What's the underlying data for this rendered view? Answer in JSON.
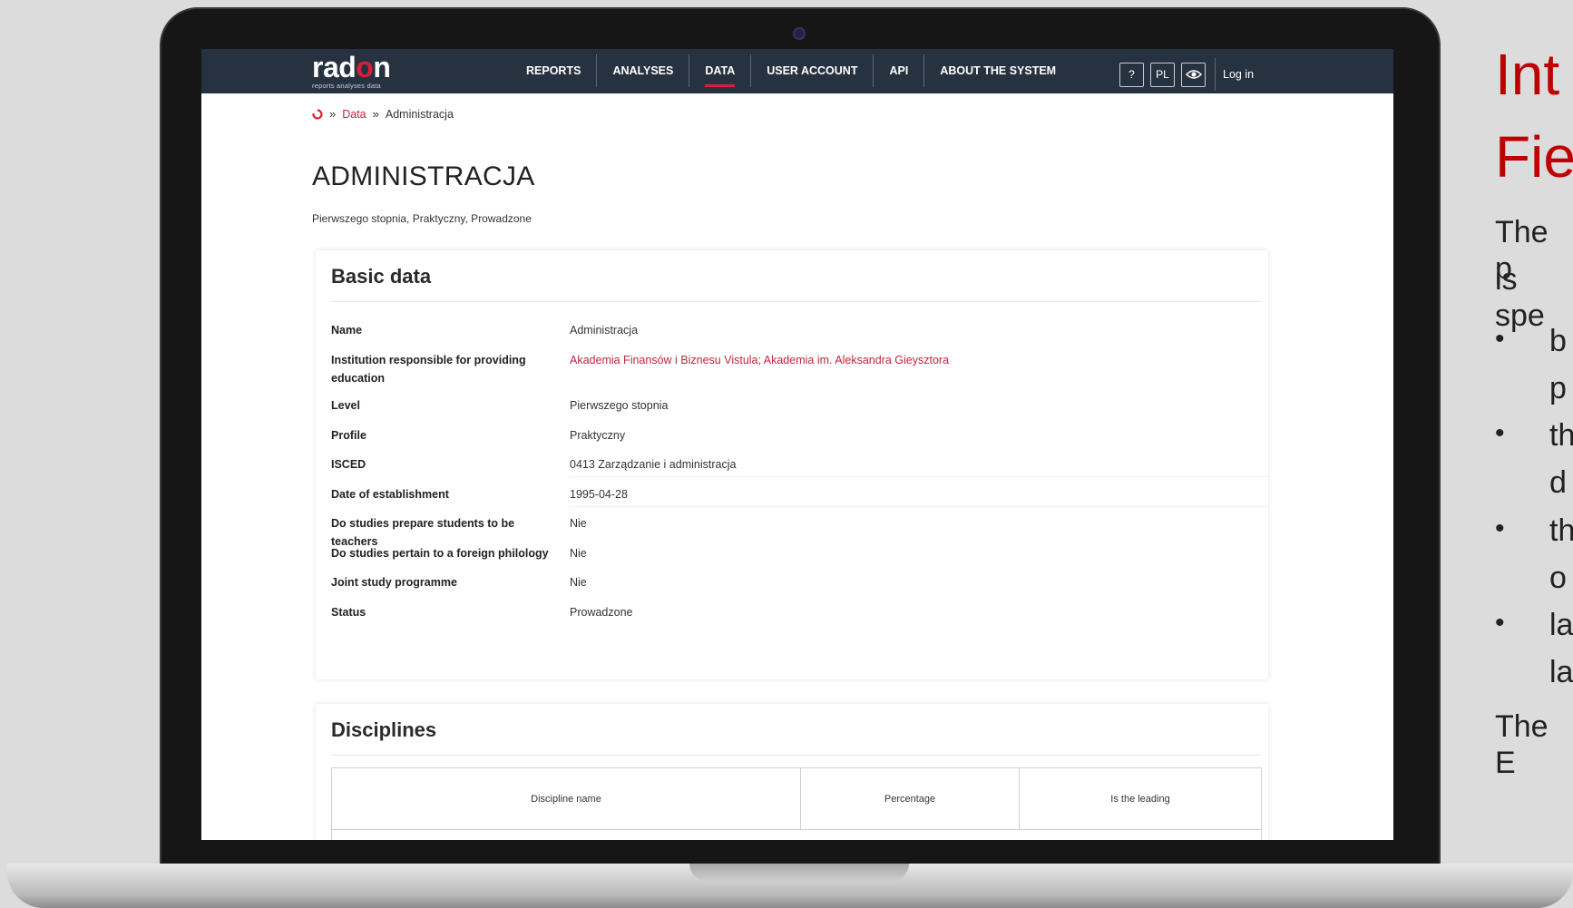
{
  "app": {
    "logo_text_start": "rad",
    "logo_text_o": "o",
    "logo_text_end": "n",
    "logo_subtitle": "reports   analyses   data"
  },
  "nav": {
    "items": [
      {
        "label": "REPORTS",
        "active": false
      },
      {
        "label": "ANALYSES",
        "active": false
      },
      {
        "label": "DATA",
        "active": true
      },
      {
        "label": "USER ACCOUNT",
        "active": false
      },
      {
        "label": "API",
        "active": false
      },
      {
        "label": "ABOUT THE SYSTEM",
        "active": false
      }
    ],
    "help_label": "?",
    "lang_label": "PL",
    "login_label": "Log in"
  },
  "breadcrumb": {
    "home_icon": "radon-home-icon",
    "separator": "»",
    "items": [
      "Data",
      "Administracja"
    ]
  },
  "page": {
    "title": "ADMINISTRACJA",
    "subtitle": "Pierwszego stopnia, Praktyczny, Prowadzone"
  },
  "basic_data": {
    "title": "Basic data",
    "rows": [
      {
        "label": "Name",
        "value": "Administracja"
      },
      {
        "label": "Institution responsible for providing education",
        "value": "Akademia Finansów i Biznesu Vistula; Akademia im. Aleksandra Gieysztora",
        "link": true
      },
      {
        "label": "Level",
        "value": "Pierwszego stopnia"
      },
      {
        "label": "Profile",
        "value": "Praktyczny"
      },
      {
        "label": "ISCED",
        "value": "0413 Zarządzanie i administracja"
      },
      {
        "label": "Date of establishment",
        "value": "1995-04-28"
      },
      {
        "label": "Do studies prepare students to be teachers",
        "value": "Nie"
      },
      {
        "label": "Do studies pertain to a foreign philology",
        "value": "Nie"
      },
      {
        "label": "Joint study programme",
        "value": "Nie"
      },
      {
        "label": "Status",
        "value": "Prowadzone"
      }
    ]
  },
  "disciplines": {
    "title": "Disciplines",
    "columns": [
      "Discipline name",
      "Percentage",
      "Is the leading"
    ]
  },
  "slide": {
    "title_line1": "Int",
    "title_line2": "Fie",
    "intro_line1": "The p",
    "intro_line2": "is spe",
    "bullets": [
      {
        "line1": "b",
        "line2": "p"
      },
      {
        "line1": "th",
        "line2": "d"
      },
      {
        "line1": "th",
        "line2": "o"
      },
      {
        "line1": "la",
        "line2": "la"
      }
    ],
    "footer": "The E"
  },
  "colors": {
    "topbar": "#273241",
    "accent": "#d3203a",
    "link": "#c1253d",
    "slide_title": "#c00000"
  }
}
